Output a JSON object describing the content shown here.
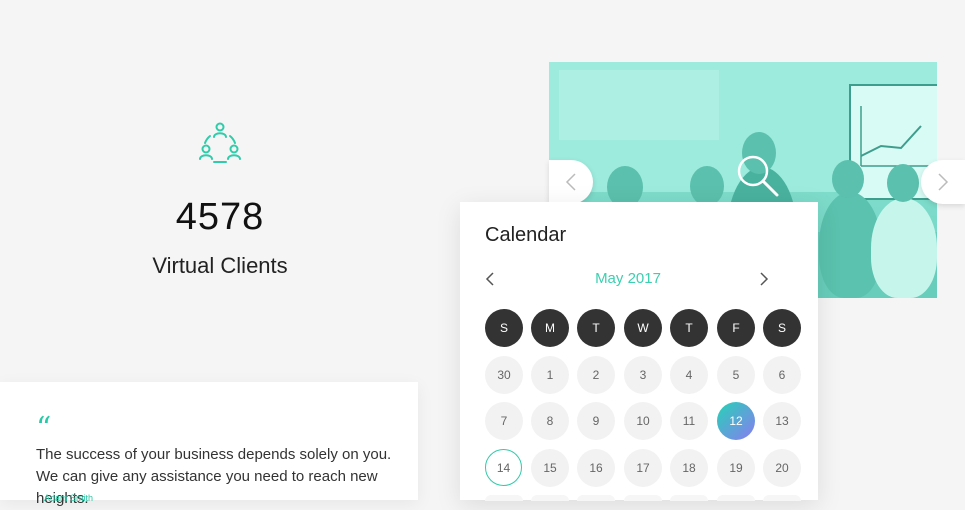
{
  "stats": {
    "icon": "people-network-icon",
    "number": "4578",
    "label": "Virtual Clients"
  },
  "slider": {
    "prev_icon": "chevron-left-icon",
    "next_icon": "chevron-right-icon",
    "zoom_icon": "search-icon"
  },
  "calendar": {
    "title": "Calendar",
    "month": "May 2017",
    "weekdays": [
      "S",
      "M",
      "T",
      "W",
      "T",
      "F",
      "S"
    ],
    "days": [
      "30",
      "1",
      "2",
      "3",
      "4",
      "5",
      "6",
      "7",
      "8",
      "9",
      "10",
      "11",
      "12",
      "13",
      "14",
      "15",
      "16",
      "17",
      "18",
      "19",
      "20"
    ],
    "selected_day": "12",
    "highlighted_day": "14",
    "accent_color": "#2ecca9"
  },
  "testimonial": {
    "quote_mark": "“",
    "text": "The success of your business depends solely on you. We can give any assistance you need to reach new heights.",
    "author": "Adam Smith"
  },
  "colors": {
    "accent": "#2ecca9",
    "dark": "#333333",
    "background": "#f5f5f5"
  }
}
